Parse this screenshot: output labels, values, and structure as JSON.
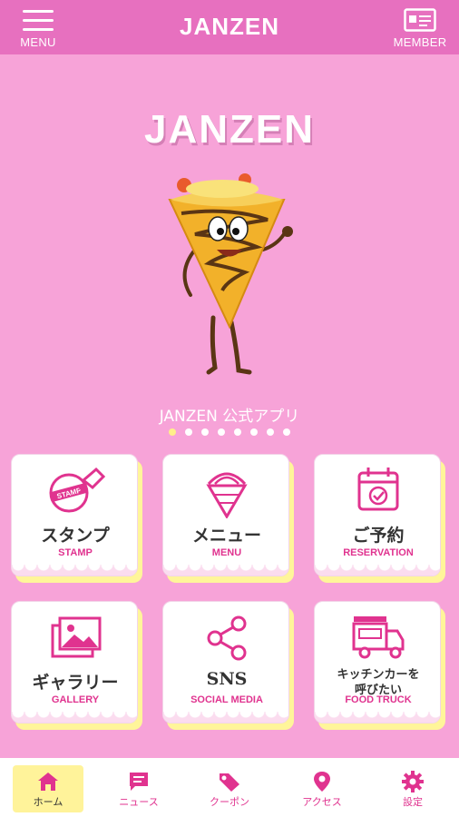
{
  "header": {
    "menu_label": "MENU",
    "title": "JANZEN",
    "member_label": "MEMBER"
  },
  "hero": {
    "title": "JANZEN",
    "subtitle": "JANZEN 公式アプリ",
    "slide_count": 8,
    "active_slide": 1
  },
  "tiles": [
    {
      "jp": "スタンプ",
      "en": "STAMP",
      "icon": "stamp-icon"
    },
    {
      "jp": "メニュー",
      "en": "MENU",
      "icon": "crepe-icon"
    },
    {
      "jp": "ご予約",
      "en": "RESERVATION",
      "icon": "calendar-icon"
    },
    {
      "jp": "ギャラリー",
      "en": "GALLERY",
      "icon": "gallery-icon"
    },
    {
      "jp": "SNS",
      "en": "SOCIAL MEDIA",
      "icon": "share-icon"
    },
    {
      "jp": "キッチンカーを\n呼びたい",
      "jp_line1": "キッチンカーを",
      "jp_line2": "呼びたい",
      "en": "FOOD TRUCK",
      "icon": "truck-icon"
    }
  ],
  "nav": [
    {
      "label": "ホーム",
      "icon": "home-icon",
      "active": true
    },
    {
      "label": "ニュース",
      "icon": "news-icon",
      "active": false
    },
    {
      "label": "クーポン",
      "icon": "coupon-icon",
      "active": false
    },
    {
      "label": "アクセス",
      "icon": "location-icon",
      "active": false
    },
    {
      "label": "設定",
      "icon": "gear-icon",
      "active": false
    }
  ],
  "colors": {
    "background": "#f7a3d8",
    "header": "#e770bf",
    "accent": "#e0338f",
    "highlight": "#fff39a"
  }
}
